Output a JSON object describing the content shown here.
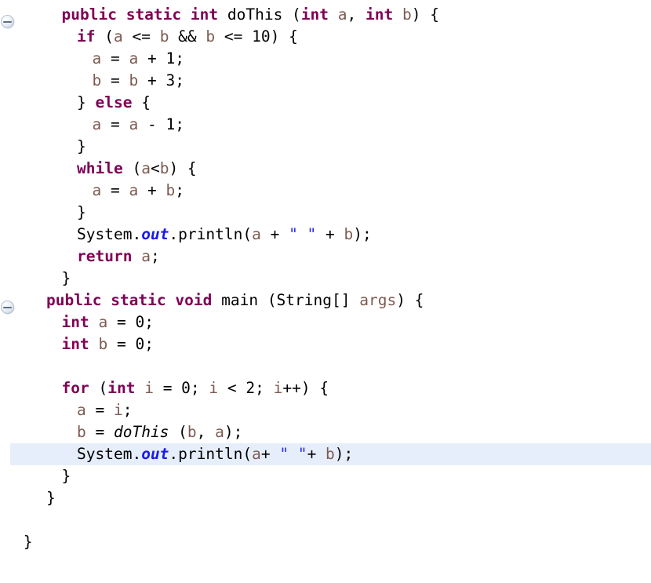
{
  "editor": {
    "language": "java",
    "background": "#ffffff",
    "highlight_color": "#e6eefb",
    "colors": {
      "keyword": "#7f0055",
      "variable": "#7d5b52",
      "string": "#2a2aff",
      "static_field": "#1a1aee",
      "plain": "#000000"
    },
    "fold_handles": [
      {
        "name": "fold-handle-doThis",
        "line": 1,
        "state": "expanded",
        "icon": "minus-circle-icon"
      },
      {
        "name": "fold-handle-main",
        "line": 14,
        "state": "expanded",
        "icon": "minus-circle-icon"
      }
    ]
  },
  "code": {
    "lines": [
      {
        "indent": 6,
        "highlight": false,
        "text": "public static int doThis (int a, int b) {",
        "tokens": [
          {
            "t": "public",
            "c": "kw"
          },
          {
            "t": " ",
            "c": "pln"
          },
          {
            "t": "static",
            "c": "kw"
          },
          {
            "t": " ",
            "c": "pln"
          },
          {
            "t": "int",
            "c": "kw"
          },
          {
            "t": " doThis (",
            "c": "pln"
          },
          {
            "t": "int",
            "c": "kw"
          },
          {
            "t": " ",
            "c": "pln"
          },
          {
            "t": "a",
            "c": "var"
          },
          {
            "t": ", ",
            "c": "pln"
          },
          {
            "t": "int",
            "c": "kw"
          },
          {
            "t": " ",
            "c": "pln"
          },
          {
            "t": "b",
            "c": "var"
          },
          {
            "t": ") {",
            "c": "pln"
          }
        ]
      },
      {
        "indent": 8,
        "highlight": false,
        "text": "if (a <= b && b <= 10) {",
        "tokens": [
          {
            "t": "if",
            "c": "kw"
          },
          {
            "t": " (",
            "c": "pln"
          },
          {
            "t": "a",
            "c": "var"
          },
          {
            "t": " <= ",
            "c": "pln"
          },
          {
            "t": "b",
            "c": "var"
          },
          {
            "t": " && ",
            "c": "pln"
          },
          {
            "t": "b",
            "c": "var"
          },
          {
            "t": " <= 10) {",
            "c": "pln"
          }
        ]
      },
      {
        "indent": 10,
        "highlight": false,
        "text": "a = a + 1;",
        "tokens": [
          {
            "t": "a",
            "c": "var"
          },
          {
            "t": " = ",
            "c": "pln"
          },
          {
            "t": "a",
            "c": "var"
          },
          {
            "t": " + 1;",
            "c": "pln"
          }
        ]
      },
      {
        "indent": 10,
        "highlight": false,
        "text": "b = b + 3;",
        "tokens": [
          {
            "t": "b",
            "c": "var"
          },
          {
            "t": " = ",
            "c": "pln"
          },
          {
            "t": "b",
            "c": "var"
          },
          {
            "t": " + 3;",
            "c": "pln"
          }
        ]
      },
      {
        "indent": 8,
        "highlight": false,
        "text": "} else {",
        "tokens": [
          {
            "t": "} ",
            "c": "pln"
          },
          {
            "t": "else",
            "c": "kw"
          },
          {
            "t": " {",
            "c": "pln"
          }
        ]
      },
      {
        "indent": 10,
        "highlight": false,
        "text": "a = a - 1;",
        "tokens": [
          {
            "t": "a",
            "c": "var"
          },
          {
            "t": " = ",
            "c": "pln"
          },
          {
            "t": "a",
            "c": "var"
          },
          {
            "t": " - 1;",
            "c": "pln"
          }
        ]
      },
      {
        "indent": 8,
        "highlight": false,
        "text": "}",
        "tokens": [
          {
            "t": "}",
            "c": "pln"
          }
        ]
      },
      {
        "indent": 8,
        "highlight": false,
        "text": "while (a<b) {",
        "tokens": [
          {
            "t": "while",
            "c": "kw"
          },
          {
            "t": " (",
            "c": "pln"
          },
          {
            "t": "a",
            "c": "var"
          },
          {
            "t": "<",
            "c": "pln"
          },
          {
            "t": "b",
            "c": "var"
          },
          {
            "t": ") {",
            "c": "pln"
          }
        ]
      },
      {
        "indent": 10,
        "highlight": false,
        "text": "a = a + b;",
        "tokens": [
          {
            "t": "a",
            "c": "var"
          },
          {
            "t": " = ",
            "c": "pln"
          },
          {
            "t": "a",
            "c": "var"
          },
          {
            "t": " + ",
            "c": "pln"
          },
          {
            "t": "b",
            "c": "var"
          },
          {
            "t": ";",
            "c": "pln"
          }
        ]
      },
      {
        "indent": 8,
        "highlight": false,
        "text": "}",
        "tokens": [
          {
            "t": "}",
            "c": "pln"
          }
        ]
      },
      {
        "indent": 8,
        "highlight": false,
        "text": "System.out.println(a + \" \" + b);",
        "tokens": [
          {
            "t": "System.",
            "c": "pln"
          },
          {
            "t": "out",
            "c": "fld"
          },
          {
            "t": ".println(",
            "c": "pln"
          },
          {
            "t": "a",
            "c": "var"
          },
          {
            "t": " + ",
            "c": "pln"
          },
          {
            "t": "\" \"",
            "c": "str"
          },
          {
            "t": " + ",
            "c": "pln"
          },
          {
            "t": "b",
            "c": "var"
          },
          {
            "t": ");",
            "c": "pln"
          }
        ]
      },
      {
        "indent": 8,
        "highlight": false,
        "text": "return a;",
        "tokens": [
          {
            "t": "return",
            "c": "kw"
          },
          {
            "t": " ",
            "c": "pln"
          },
          {
            "t": "a",
            "c": "var"
          },
          {
            "t": ";",
            "c": "pln"
          }
        ]
      },
      {
        "indent": 6,
        "highlight": false,
        "text": "}",
        "tokens": [
          {
            "t": "}",
            "c": "pln"
          }
        ]
      },
      {
        "indent": 4,
        "highlight": false,
        "text": "public static void main (String[] args) {",
        "tokens": [
          {
            "t": "public",
            "c": "kw"
          },
          {
            "t": " ",
            "c": "pln"
          },
          {
            "t": "static",
            "c": "kw"
          },
          {
            "t": " ",
            "c": "pln"
          },
          {
            "t": "void",
            "c": "kw"
          },
          {
            "t": " main (String[] ",
            "c": "pln"
          },
          {
            "t": "args",
            "c": "var"
          },
          {
            "t": ") {",
            "c": "pln"
          }
        ]
      },
      {
        "indent": 6,
        "highlight": false,
        "text": "int a = 0;",
        "tokens": [
          {
            "t": "int",
            "c": "kw"
          },
          {
            "t": " ",
            "c": "pln"
          },
          {
            "t": "a",
            "c": "var"
          },
          {
            "t": " = 0;",
            "c": "pln"
          }
        ]
      },
      {
        "indent": 6,
        "highlight": false,
        "text": "int b = 0;",
        "tokens": [
          {
            "t": "int",
            "c": "kw"
          },
          {
            "t": " ",
            "c": "pln"
          },
          {
            "t": "b",
            "c": "var"
          },
          {
            "t": " = 0;",
            "c": "pln"
          }
        ]
      },
      {
        "indent": 0,
        "highlight": false,
        "text": "",
        "tokens": [
          {
            "t": "",
            "c": "pln"
          }
        ]
      },
      {
        "indent": 6,
        "highlight": false,
        "text": "for (int i = 0; i < 2; i++) {",
        "tokens": [
          {
            "t": "for",
            "c": "kw"
          },
          {
            "t": " (",
            "c": "pln"
          },
          {
            "t": "int",
            "c": "kw"
          },
          {
            "t": " ",
            "c": "pln"
          },
          {
            "t": "i",
            "c": "var"
          },
          {
            "t": " = 0; ",
            "c": "pln"
          },
          {
            "t": "i",
            "c": "var"
          },
          {
            "t": " < 2; ",
            "c": "pln"
          },
          {
            "t": "i",
            "c": "var"
          },
          {
            "t": "++) {",
            "c": "pln"
          }
        ]
      },
      {
        "indent": 8,
        "highlight": false,
        "text": "a = i;",
        "tokens": [
          {
            "t": "a",
            "c": "var"
          },
          {
            "t": " = ",
            "c": "pln"
          },
          {
            "t": "i",
            "c": "var"
          },
          {
            "t": ";",
            "c": "pln"
          }
        ]
      },
      {
        "indent": 8,
        "highlight": false,
        "text": "b = doThis (b, a);",
        "tokens": [
          {
            "t": "b",
            "c": "var"
          },
          {
            "t": " = ",
            "c": "pln"
          },
          {
            "t": "doThis",
            "c": "mth"
          },
          {
            "t": " (",
            "c": "pln"
          },
          {
            "t": "b",
            "c": "var"
          },
          {
            "t": ", ",
            "c": "pln"
          },
          {
            "t": "a",
            "c": "var"
          },
          {
            "t": ");",
            "c": "pln"
          }
        ]
      },
      {
        "indent": 8,
        "highlight": true,
        "text": "System.out.println(a+ \" \"+ b);",
        "tokens": [
          {
            "t": "System.",
            "c": "pln"
          },
          {
            "t": "out",
            "c": "fld"
          },
          {
            "t": ".println(",
            "c": "pln"
          },
          {
            "t": "a",
            "c": "var"
          },
          {
            "t": "+ ",
            "c": "pln"
          },
          {
            "t": "\" \"",
            "c": "str"
          },
          {
            "t": "+ ",
            "c": "pln"
          },
          {
            "t": "b",
            "c": "var"
          },
          {
            "t": ");",
            "c": "pln"
          }
        ]
      },
      {
        "indent": 6,
        "highlight": false,
        "text": "}",
        "tokens": [
          {
            "t": "}",
            "c": "pln"
          }
        ]
      },
      {
        "indent": 4,
        "highlight": false,
        "text": "}",
        "tokens": [
          {
            "t": "}",
            "c": "pln"
          }
        ]
      },
      {
        "indent": 0,
        "highlight": false,
        "text": "",
        "tokens": [
          {
            "t": "",
            "c": "pln"
          }
        ]
      },
      {
        "indent": 1,
        "highlight": false,
        "text": "}",
        "tokens": [
          {
            "t": "}",
            "c": "pln"
          }
        ]
      }
    ]
  }
}
